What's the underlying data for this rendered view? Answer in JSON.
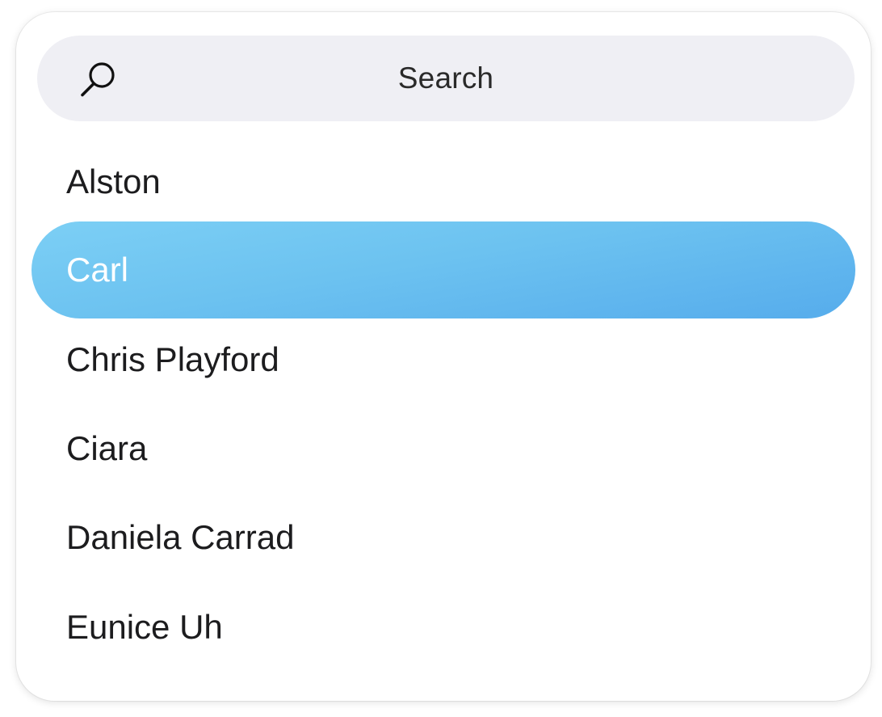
{
  "search": {
    "placeholder": "Search",
    "icon": "search-icon"
  },
  "list": {
    "items": [
      {
        "label": "Alston",
        "selected": false
      },
      {
        "label": "Carl",
        "selected": true
      },
      {
        "label": "Chris Playford",
        "selected": false
      },
      {
        "label": "Ciara",
        "selected": false
      },
      {
        "label": "Daniela Carrad",
        "selected": false
      },
      {
        "label": "Eunice Uh",
        "selected": false
      }
    ]
  },
  "colors": {
    "selected_background": "#5fb6ee",
    "search_background": "#efeff4",
    "text": "#1c1c1e",
    "selected_text": "#ffffff"
  }
}
